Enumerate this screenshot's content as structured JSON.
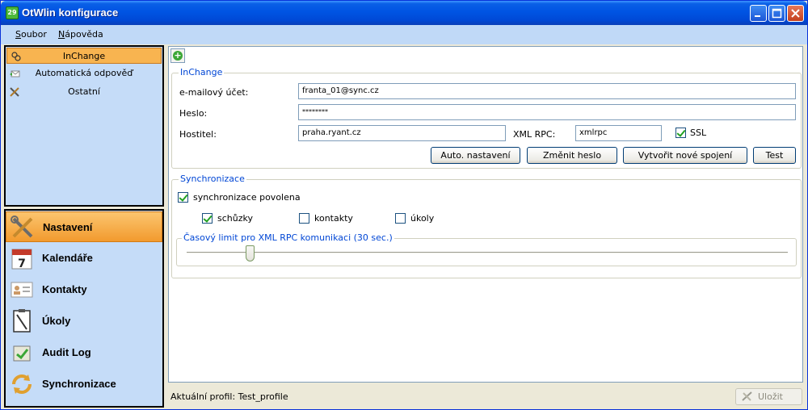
{
  "window": {
    "title": "OtWlin konfigurace",
    "icon": "app-calendar-icon"
  },
  "menu": [
    {
      "label": "Soubor",
      "accel": "S",
      "rest": "oubor"
    },
    {
      "label": "Nápověda",
      "accel": "N",
      "rest": "ápověda"
    }
  ],
  "left_top": {
    "items": [
      {
        "label": "InChange",
        "icon": "accounts-icon",
        "selected": true
      },
      {
        "label": "Automatická odpověď",
        "icon": "auto-reply-icon",
        "selected": false
      },
      {
        "label": "Ostatní",
        "icon": "tools-icon",
        "selected": false
      }
    ]
  },
  "nav": {
    "items": [
      {
        "label": "Nastavení",
        "icon": "settings-tools-icon",
        "selected": true
      },
      {
        "label": "Kalendáře",
        "icon": "calendar-icon",
        "selected": false
      },
      {
        "label": "Kontakty",
        "icon": "contacts-icon",
        "selected": false
      },
      {
        "label": "Úkoly",
        "icon": "tasks-icon",
        "selected": false
      },
      {
        "label": "Audit Log",
        "icon": "audit-log-icon",
        "selected": false
      },
      {
        "label": "Synchronizace",
        "icon": "sync-icon",
        "selected": false
      }
    ]
  },
  "inchange": {
    "legend": "InChange",
    "email_label": "e-mailový účet:",
    "email_value": "franta_01@sync.cz",
    "password_label": "Heslo:",
    "password_value": "********",
    "host_label": "Hostitel:",
    "host_value": "praha.ryant.cz",
    "xmlrpc_label": "XML RPC:",
    "xmlrpc_value": "xmlrpc",
    "ssl_label": "SSL",
    "ssl_checked": true,
    "buttons": {
      "auto": "Auto. nastavení",
      "change_password": "Změnit heslo",
      "new_connection": "Vytvořit nové spojení",
      "test": "Test"
    }
  },
  "sync": {
    "legend": "Synchronizace",
    "enabled_label": "synchronizace povolena",
    "enabled": true,
    "meetings_label": "schůzky",
    "meetings": true,
    "contacts_label": "kontakty",
    "contacts": false,
    "tasks_label": "úkoly",
    "tasks": false,
    "timeout_legend": "Časový limit pro XML RPC komunikaci (30 sec.)",
    "timeout_seconds": 30
  },
  "status": {
    "profile_text": "Aktuální profil: Test_profile",
    "save_label": "Uložit"
  }
}
